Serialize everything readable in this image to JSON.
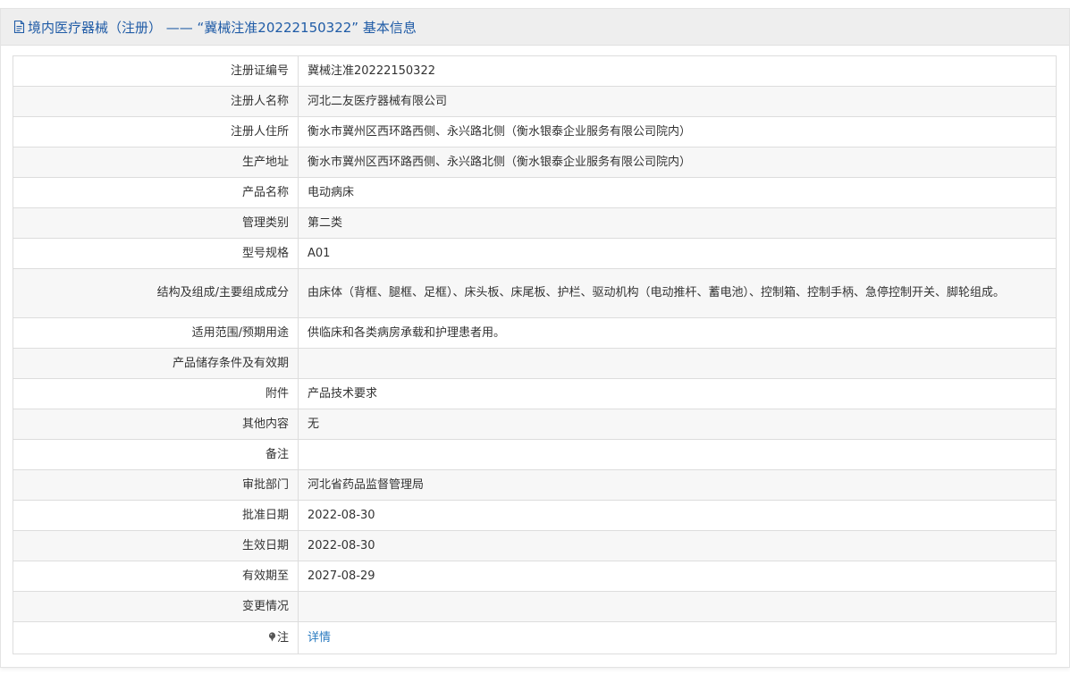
{
  "header": {
    "title": "境内医疗器械（注册）  ——  “冀械注准20222150322”  基本信息",
    "icon": "document-icon",
    "color": "#1f5ba6"
  },
  "rows": [
    {
      "label": "注册证编号",
      "value": "冀械注准20222150322"
    },
    {
      "label": "注册人名称",
      "value": "河北二友医疗器械有限公司"
    },
    {
      "label": "注册人住所",
      "value": "衡水市冀州区西环路西侧、永兴路北侧（衡水银泰企业服务有限公司院内）"
    },
    {
      "label": "生产地址",
      "value": "衡水市冀州区西环路西侧、永兴路北侧（衡水银泰企业服务有限公司院内）"
    },
    {
      "label": "产品名称",
      "value": "电动病床"
    },
    {
      "label": "管理类别",
      "value": "第二类"
    },
    {
      "label": "型号规格",
      "value": "A01"
    },
    {
      "label": "结构及组成/主要组成成分",
      "value": "由床体（背框、腿框、足框）、床头板、床尾板、护栏、驱动机构（电动推杆、蓄电池）、控制箱、控制手柄、急停控制开关、脚轮组成。"
    },
    {
      "label": "适用范围/预期用途",
      "value": "供临床和各类病房承载和护理患者用。"
    },
    {
      "label": "产品储存条件及有效期",
      "value": ""
    },
    {
      "label": "附件",
      "value": "产品技术要求"
    },
    {
      "label": "其他内容",
      "value": "无"
    },
    {
      "label": "备注",
      "value": ""
    },
    {
      "label": "审批部门",
      "value": "河北省药品监督管理局"
    },
    {
      "label": "批准日期",
      "value": "2022-08-30"
    },
    {
      "label": "生效日期",
      "value": "2022-08-30"
    },
    {
      "label": "有效期至",
      "value": "2027-08-29"
    },
    {
      "label": "变更情况",
      "value": ""
    }
  ],
  "note": {
    "label": "注",
    "icon": "pin-icon",
    "link_label": "详情",
    "link_color": "#2a7bc0"
  }
}
